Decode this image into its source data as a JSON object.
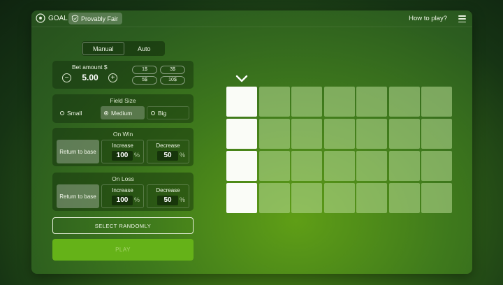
{
  "header": {
    "logo_label": "GOAL",
    "provably_fair_label": "Provably Fair",
    "how_to_play_label": "How to play?"
  },
  "tabs": {
    "manual": "Manual",
    "auto": "Auto",
    "active": "Manual"
  },
  "bet": {
    "label": "Bet amount $",
    "value": "5.00",
    "minus": "−",
    "plus": "+",
    "quick": [
      "1$",
      "3$",
      "5$",
      "10$"
    ]
  },
  "field": {
    "title": "Field Size",
    "options": [
      "Small",
      "Medium",
      "Big"
    ],
    "selected": "Medium"
  },
  "on_win": {
    "title": "On Win",
    "return_label": "Return to base",
    "increase_label": "Increase",
    "increase_value": "100",
    "decrease_label": "Decrease",
    "decrease_value": "50",
    "percent": "%"
  },
  "on_loss": {
    "title": "On Loss",
    "return_label": "Return to base",
    "increase_label": "Increase",
    "increase_value": "100",
    "decrease_label": "Decrease",
    "decrease_value": "50",
    "percent": "%"
  },
  "actions": {
    "select_randomly": "SELECT RANDOMLY",
    "play": "PLAY"
  },
  "board": {
    "rows": 4,
    "cols": 7,
    "active_column": 1
  },
  "colors": {
    "accent": "#65b218",
    "active_cell": "#fafcf7",
    "cell": "#9fcf7a"
  }
}
